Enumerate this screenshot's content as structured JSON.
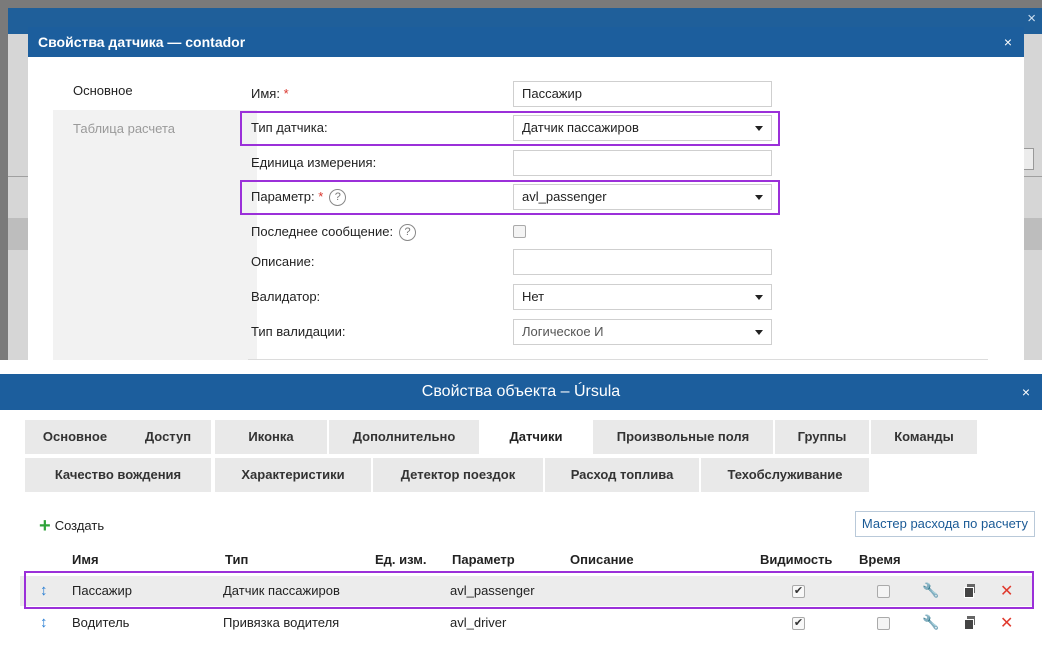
{
  "sensor_dialog": {
    "title": "Свойства датчика — contador",
    "close_glyph": "×",
    "tabs": [
      {
        "label": "Основное",
        "active": true
      },
      {
        "label": "Таблица расчета",
        "active": false
      }
    ],
    "fields": {
      "name": {
        "label": "Имя:",
        "required_mark": "*",
        "value": "Пассажир"
      },
      "sensor_type": {
        "label": "Тип датчика:",
        "value": "Датчик пассажиров"
      },
      "unit": {
        "label": "Единица измерения:",
        "value": ""
      },
      "parameter": {
        "label": "Параметр:",
        "required_mark": "*",
        "help": "?",
        "value": "avl_passenger"
      },
      "last_message": {
        "label": "Последнее сообщение:",
        "help": "?",
        "checked": false
      },
      "description": {
        "label": "Описание:",
        "value": ""
      },
      "validator": {
        "label": "Валидатор:",
        "value": "Нет"
      },
      "validation_type": {
        "label": "Тип валидации:",
        "value": "Логическое И"
      }
    }
  },
  "object_dialog": {
    "title": "Свойства объекта – Úrsula",
    "close_glyph": "×",
    "tabs_row1": [
      "Основное",
      "Доступ",
      "Иконка",
      "Дополнительно",
      "Датчики",
      "Произвольные поля",
      "Группы",
      "Команды"
    ],
    "tabs_row2": [
      "Качество вождения",
      "Характеристики",
      "Детектор поездок",
      "Расход топлива",
      "Техобслуживание"
    ],
    "active_tab": "Датчики",
    "toolbar": {
      "create_label": "Создать",
      "create_icon": "+",
      "wizard_label": "Мастер расхода по расчету"
    },
    "table": {
      "headers": {
        "name": "Имя",
        "type": "Тип",
        "unit": "Ед. изм.",
        "parameter": "Параметр",
        "description": "Описание",
        "visibility": "Видимость",
        "time": "Время"
      },
      "rows": [
        {
          "name": "Пассажир",
          "type": "Датчик пассажиров",
          "unit": "",
          "parameter": "avl_passenger",
          "description": "",
          "visible": true,
          "time": false,
          "selected": true
        },
        {
          "name": "Водитель",
          "type": "Привязка водителя",
          "unit": "",
          "parameter": "avl_driver",
          "description": "",
          "visible": true,
          "time": false,
          "selected": false
        }
      ],
      "check_glyph": "✔",
      "drag_glyph": "↕",
      "wrench_glyph": "🔧",
      "delete_glyph": "✕"
    }
  },
  "colors": {
    "titlebar": "#1c5e9d",
    "highlight": "#9b30d9",
    "required": "#d9342b",
    "add_green": "#2fa33a",
    "delete_red": "#e03a2e",
    "drag_blue": "#2a7fd4"
  }
}
